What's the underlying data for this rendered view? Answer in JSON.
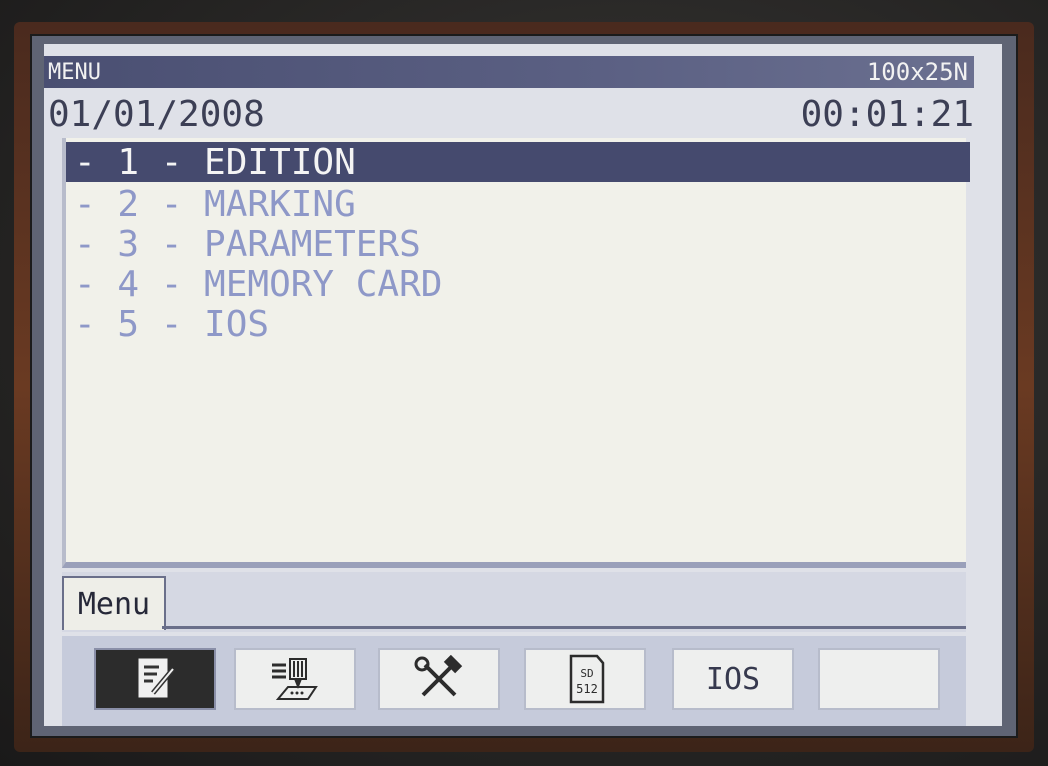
{
  "titlebar": {
    "title": "MENU",
    "mode": "100x25N"
  },
  "status": {
    "date": "01/01/2008",
    "time": "00:01:21"
  },
  "menu": {
    "items": [
      {
        "label": "- 1 - EDITION",
        "selected": true
      },
      {
        "label": "- 2 - MARKING",
        "selected": false
      },
      {
        "label": "- 3 - PARAMETERS",
        "selected": false
      },
      {
        "label": "- 4 - MEMORY CARD",
        "selected": false
      },
      {
        "label": "- 5 - IOS",
        "selected": false
      }
    ]
  },
  "tabs": [
    {
      "label": "Menu",
      "active": true
    }
  ],
  "toolbar": {
    "buttons": [
      {
        "icon": "edit-document-icon",
        "active": true
      },
      {
        "icon": "marking-head-icon",
        "active": false
      },
      {
        "icon": "tools-icon",
        "active": false
      },
      {
        "icon": "sd-card-icon",
        "label": "SD 512",
        "active": false
      },
      {
        "icon": "",
        "label": "IOS",
        "active": false
      },
      {
        "icon": "",
        "label": "",
        "active": false
      }
    ]
  },
  "colors": {
    "title_bar": "#4a4f72",
    "selected_bg": "#454a6e",
    "item_text": "#8e98c8",
    "list_bg": "#f1f1ea"
  }
}
